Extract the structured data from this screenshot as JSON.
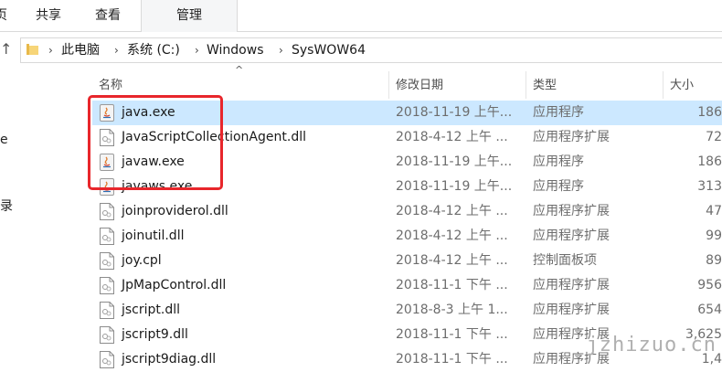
{
  "ribbon": {
    "tabs": [
      {
        "label": "页",
        "active": false
      },
      {
        "label": "共享",
        "active": false
      },
      {
        "label": "查看",
        "active": false
      },
      {
        "label": "管理",
        "active": true
      }
    ]
  },
  "address": {
    "up_glyph": "↑",
    "path": [
      "此电脑",
      "系统 (C:)",
      "Windows",
      "SysWOW64"
    ],
    "separator": "›"
  },
  "nav_fragments": [
    "e",
    "录"
  ],
  "columns": {
    "name": "名称",
    "date": "修改日期",
    "type": "类型",
    "size": "大小",
    "sort_indicator": "^"
  },
  "files": [
    {
      "name": "java.exe",
      "date": "2018-11-19 上午...",
      "type": "应用程序",
      "size": "186",
      "icon": "java-app-icon",
      "selected": true
    },
    {
      "name": "JavaScriptCollectionAgent.dll",
      "date": "2018-4-12 上午 ...",
      "type": "应用程序扩展",
      "size": "72",
      "icon": "dll-file-icon",
      "selected": false
    },
    {
      "name": "javaw.exe",
      "date": "2018-11-19 上午...",
      "type": "应用程序",
      "size": "186",
      "icon": "java-app-icon",
      "selected": false
    },
    {
      "name": "javaws.exe",
      "date": "2018-11-19 上午...",
      "type": "应用程序",
      "size": "313",
      "icon": "java-app-icon",
      "selected": false
    },
    {
      "name": "joinproviderol.dll",
      "date": "2018-4-12 上午 ...",
      "type": "应用程序扩展",
      "size": "47",
      "icon": "dll-file-icon",
      "selected": false
    },
    {
      "name": "joinutil.dll",
      "date": "2018-4-12 上午 ...",
      "type": "应用程序扩展",
      "size": "99",
      "icon": "dll-file-icon",
      "selected": false
    },
    {
      "name": "joy.cpl",
      "date": "2018-4-12 上午 ...",
      "type": "控制面板项",
      "size": "89",
      "icon": "cpl-file-icon",
      "selected": false
    },
    {
      "name": "JpMapControl.dll",
      "date": "2018-11-1 下午 ...",
      "type": "应用程序扩展",
      "size": "956",
      "icon": "dll-file-icon",
      "selected": false
    },
    {
      "name": "jscript.dll",
      "date": "2018-8-3 上午 1...",
      "type": "应用程序扩展",
      "size": "654",
      "icon": "dll-file-icon",
      "selected": false
    },
    {
      "name": "jscript9.dll",
      "date": "2018-11-1 下午 ...",
      "type": "应用程序扩展",
      "size": "3,625",
      "icon": "dll-file-icon",
      "selected": false
    },
    {
      "name": "jscript9diag.dll",
      "date": "2018-11-1 下午 ...",
      "type": "应用程序扩展",
      "size": "1,4",
      "icon": "dll-file-icon",
      "selected": false
    }
  ],
  "watermark": "jzhizuo.cn",
  "colors": {
    "selection": "#cce8ff",
    "highlight_box": "#e8262b"
  }
}
